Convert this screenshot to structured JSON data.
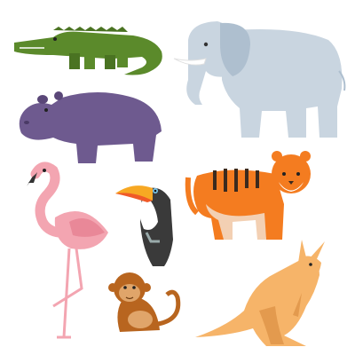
{
  "animals": [
    {
      "id": "crocodile",
      "color": "#5b8a2b",
      "accent": "#4a7322"
    },
    {
      "id": "elephant",
      "color": "#c9d5e0",
      "accent": "#aebfcf"
    },
    {
      "id": "hippo",
      "color": "#6e5a8f",
      "accent": "#5a4778"
    },
    {
      "id": "flamingo",
      "color": "#f3a5b1",
      "accent": "#e98898"
    },
    {
      "id": "toucan",
      "color": "#3a3a3a",
      "accent": "#f7a823"
    },
    {
      "id": "tiger",
      "color": "#f47c20",
      "accent": "#3b2a1e"
    },
    {
      "id": "monkey",
      "color": "#b8651f",
      "accent": "#e0a56a"
    },
    {
      "id": "kangaroo",
      "color": "#f6b469",
      "accent": "#e39a4e"
    }
  ],
  "background": "#ffffff"
}
